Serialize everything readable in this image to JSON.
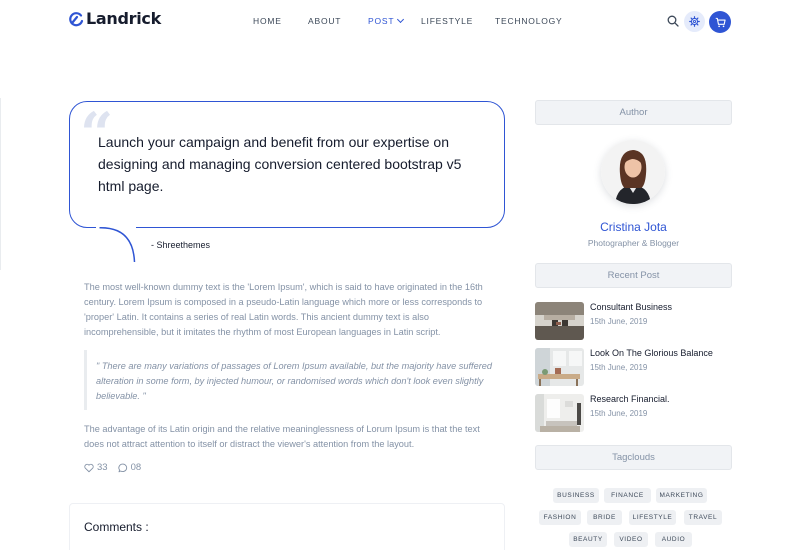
{
  "brand": {
    "name": "Landrick",
    "accent": "#2f55d4"
  },
  "nav": {
    "items": [
      {
        "label": "HOME",
        "active": false
      },
      {
        "label": "ABOUT",
        "active": false
      },
      {
        "label": "POST",
        "active": true,
        "dropdown": true
      },
      {
        "label": "LIFESTYLE",
        "active": false
      },
      {
        "label": "TECHNOLOGY",
        "active": false
      }
    ],
    "icons": [
      "search-icon",
      "gear-icon",
      "cart-icon"
    ]
  },
  "article": {
    "quote": "Launch your campaign and benefit from our expertise on designing and managing conversion centered bootstrap v5 html page.",
    "quote_author": "- Shreethemes",
    "paragraph1": "The most well-known dummy text is the 'Lorem Ipsum', which is said to have originated in the 16th century. Lorem Ipsum is composed in a pseudo-Latin language which more or less corresponds to 'proper' Latin. It contains a series of real Latin words. This ancient dummy text is also incomprehensible, but it imitates the rhythm of most European languages in Latin script.",
    "blockquote": "\" There are many variations of passages of Lorem Ipsum available, but the majority have suffered alteration in some form, by injected humour, or randomised words which don't look even slightly believable. \"",
    "paragraph2": "The advantage of its Latin origin and the relative meaninglessness of Lorum Ipsum is that the text does not attract attention to itself or distract the viewer's attention from the layout.",
    "likes": "33",
    "comments_count": "08",
    "comments_title": "Comments :"
  },
  "sidebar": {
    "author_heading": "Author",
    "author_name": "Cristina Jota",
    "author_role": "Photographer & Blogger",
    "recent_heading": "Recent Post",
    "recent_posts": [
      {
        "title": "Consultant Business",
        "date": "15th June, 2019"
      },
      {
        "title": "Look On The Glorious Balance",
        "date": "15th June, 2019"
      },
      {
        "title": "Research Financial.",
        "date": "15th June, 2019"
      }
    ],
    "tags_heading": "Tagclouds",
    "tags": [
      "BUSINESS",
      "FINANCE",
      "MARKETING",
      "FASHION",
      "BRIDE",
      "LIFESTYLE",
      "TRAVEL",
      "BEAUTY",
      "VIDEO",
      "AUDIO"
    ]
  }
}
